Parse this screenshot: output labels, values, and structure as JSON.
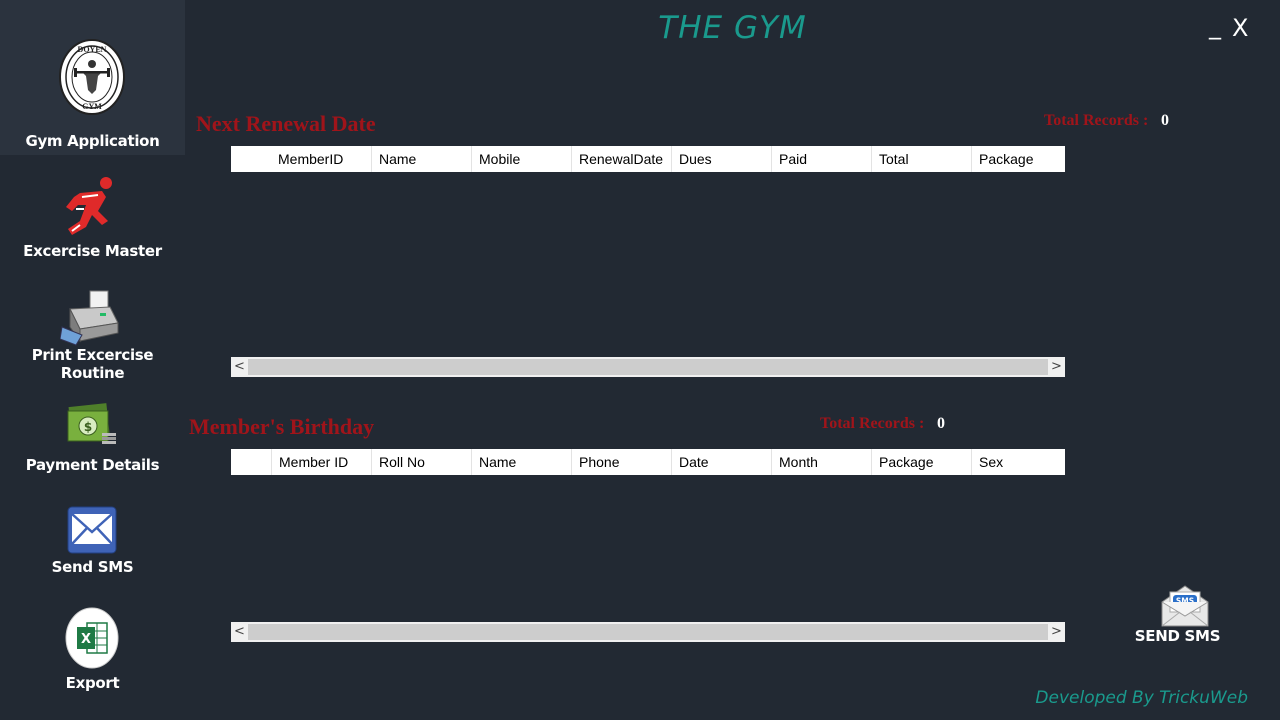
{
  "app": {
    "title": "THE GYM",
    "minimize_label": "_",
    "close_label": "X",
    "developer_credit": "Developed By TrickuWeb"
  },
  "sidebar": {
    "items": [
      {
        "label": "Gym Application",
        "icon": "gym-logo-icon",
        "logo_text_top": "DOYEN",
        "logo_text_bottom": "GYM"
      },
      {
        "label": "Excercise Master",
        "icon": "running-man-icon"
      },
      {
        "label": "Print Excercise Routine",
        "icon": "printer-icon"
      },
      {
        "label": "Payment Details",
        "icon": "money-icon"
      },
      {
        "label": "Send SMS",
        "icon": "envelope-icon"
      },
      {
        "label": "Export",
        "icon": "excel-icon"
      }
    ]
  },
  "renewal": {
    "title": "Next Renewal Date",
    "total_label": "Total Records :",
    "total_value": "0",
    "columns": [
      "MemberID",
      "Name",
      "Mobile",
      "RenewalDate",
      "Dues",
      "Paid",
      "Total",
      "Package"
    ],
    "rows": []
  },
  "birthday": {
    "title": "Member's Birthday",
    "total_label": "Total Records :",
    "total_value": "0",
    "columns": [
      "Member ID",
      "Roll No",
      "Name",
      "Phone",
      "Date",
      "Month",
      "Package",
      "Sex"
    ],
    "rows": []
  },
  "scrollbar": {
    "left_arrow": "<",
    "right_arrow": ">"
  },
  "sms_button": {
    "label": "SEND SMS",
    "badge": "SMS"
  },
  "colors": {
    "background": "#222933",
    "accent_teal": "#1a9a8d",
    "section_red": "#a0141a"
  }
}
